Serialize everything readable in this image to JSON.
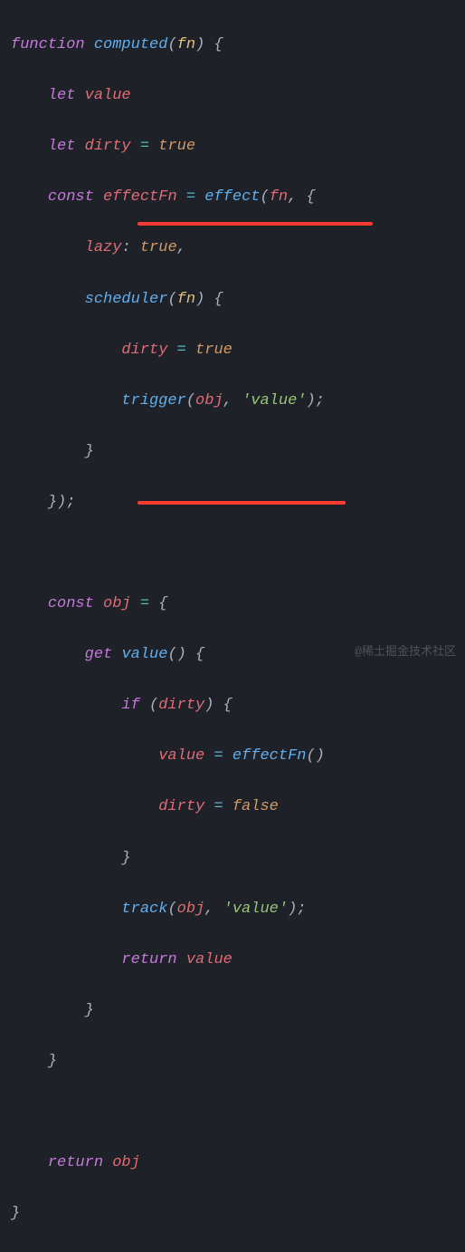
{
  "code": {
    "l1": {
      "kw1": "function",
      "fn": "computed",
      "p1": "(",
      "param": "fn",
      "p2": ") {"
    },
    "l2": {
      "kw": "let",
      "var": "value"
    },
    "l3": {
      "kw": "let",
      "var": "dirty",
      "op": "=",
      "val": "true"
    },
    "l4": {
      "kw": "const",
      "var": "effectFn",
      "op": "=",
      "fn": "effect",
      "p1": "(",
      "param": "fn",
      "p2": ", {"
    },
    "l5": {
      "prop": "lazy",
      "p1": ":",
      "val": "true",
      "p2": ","
    },
    "l6": {
      "fn": "scheduler",
      "p1": "(",
      "param": "fn",
      "p2": ") {"
    },
    "l7": {
      "var": "dirty",
      "op": "=",
      "val": "true"
    },
    "l8": {
      "fn": "trigger",
      "p1": "(",
      "arg1": "obj",
      "p2": ", ",
      "str": "'value'",
      "p3": ");"
    },
    "l9": {
      "p": "}"
    },
    "l10": {
      "p": "});"
    },
    "l11": {
      "kw": "const",
      "var": "obj",
      "op": "=",
      "p": "{"
    },
    "l12": {
      "kw": "get",
      "fn": "value",
      "p": "() {"
    },
    "l13": {
      "kw": "if",
      "p1": "(",
      "var": "dirty",
      "p2": ") {"
    },
    "l14": {
      "var": "value",
      "op": "=",
      "fn": "effectFn",
      "p": "()"
    },
    "l15": {
      "var": "dirty",
      "op": "=",
      "val": "false"
    },
    "l16": {
      "p": "}"
    },
    "l17": {
      "fn": "track",
      "p1": "(",
      "arg1": "obj",
      "p2": ", ",
      "str": "'value'",
      "p3": ");"
    },
    "l18": {
      "kw": "return",
      "var": "value"
    },
    "l19": {
      "p": "}"
    },
    "l20": {
      "p": "}"
    },
    "l21": {
      "kw": "return",
      "var": "obj"
    },
    "l22": {
      "p": "}"
    }
  },
  "watermark": "@稀土掘金技术社区"
}
